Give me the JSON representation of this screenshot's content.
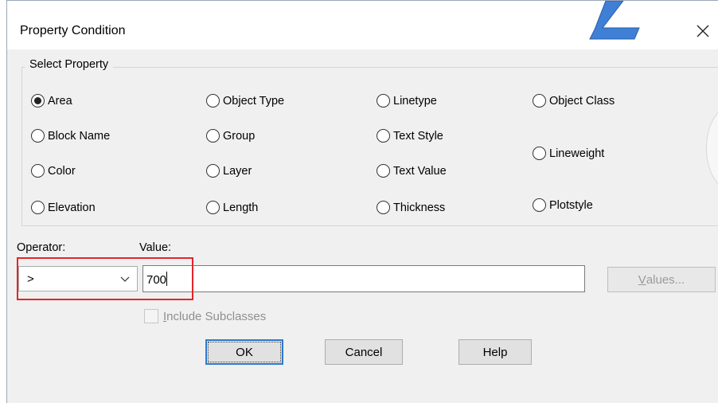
{
  "dialog": {
    "title": "Property Condition",
    "close_icon": "close-x-icon",
    "badge_icon": "step-number-badge"
  },
  "select_property": {
    "legend": "Select Property",
    "selected": "Area",
    "options": [
      "Area",
      "Object Type",
      "Linetype",
      "Object Class",
      "Block Name",
      "Group",
      "Text Style",
      "Lineweight",
      "Color",
      "Layer",
      "Text Value",
      "Elevation",
      "Length",
      "Thickness",
      "Plotstyle"
    ]
  },
  "operator": {
    "label": "Operator:",
    "value": ">"
  },
  "value": {
    "label": "Value:",
    "text": "700"
  },
  "values_button": {
    "underlined_char": "V",
    "rest": "alues..."
  },
  "include_subclasses": {
    "underlined_char": "I",
    "rest": "nclude Subclasses",
    "checked": false,
    "enabled": false
  },
  "buttons": {
    "ok": "OK",
    "cancel": "Cancel",
    "help": "Help"
  },
  "colors": {
    "highlight": "#e2262a",
    "accent": "#2b7bd1",
    "badge": "#3f7fd6"
  }
}
